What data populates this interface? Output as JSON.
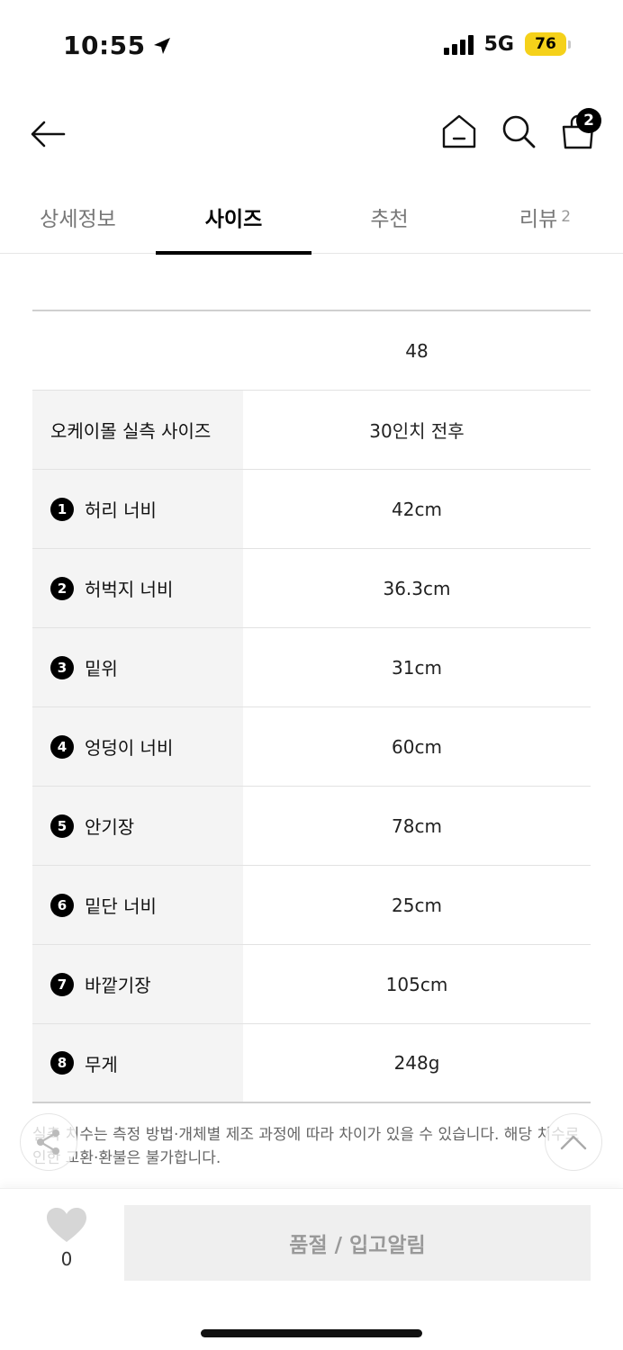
{
  "status": {
    "time": "10:55",
    "network": "5G",
    "battery": "76"
  },
  "header": {
    "cart_count": "2"
  },
  "tabs": [
    {
      "label": "상세정보"
    },
    {
      "label": "사이즈"
    },
    {
      "label": "추천"
    },
    {
      "label": "리뷰",
      "count": "2"
    }
  ],
  "table": {
    "column_header": "48",
    "rows": [
      {
        "num": "",
        "label": "오케이몰 실측 사이즈",
        "value": "30인치 전후"
      },
      {
        "num": "1",
        "label": "허리 너비",
        "value": "42cm"
      },
      {
        "num": "2",
        "label": "허벅지 너비",
        "value": "36.3cm"
      },
      {
        "num": "3",
        "label": "밑위",
        "value": "31cm"
      },
      {
        "num": "4",
        "label": "엉덩이 너비",
        "value": "60cm"
      },
      {
        "num": "5",
        "label": "안기장",
        "value": "78cm"
      },
      {
        "num": "6",
        "label": "밑단 너비",
        "value": "25cm"
      },
      {
        "num": "7",
        "label": "바깥기장",
        "value": "105cm"
      },
      {
        "num": "8",
        "label": "무게",
        "value": "248g"
      }
    ]
  },
  "note": "실측 치수는 측정 방법·개체별 제조 과정에 따라 차이가 있을 수 있습니다. 해당 치수로 인한 교환·환불은 불가합니다.",
  "bottom": {
    "like_count": "0",
    "action_label": "품절 / 입고알림"
  },
  "colors": {
    "battery": "#f5d11a",
    "label_bg": "#f4f4f4",
    "button_bg": "#efefef"
  }
}
